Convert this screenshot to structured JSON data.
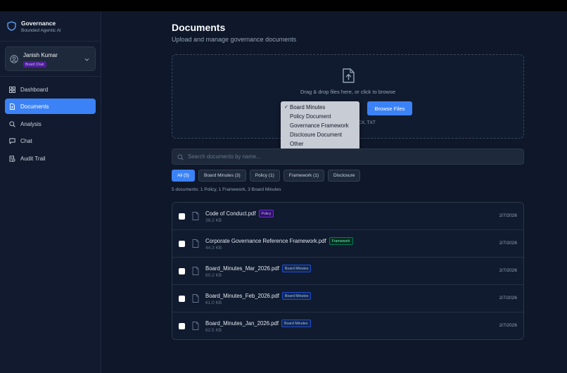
{
  "brand": {
    "title": "Governance",
    "subtitle": "Bounded Agentic AI"
  },
  "user": {
    "name": "Janish Kumar",
    "role": "Board Chair"
  },
  "nav": {
    "items": [
      {
        "label": "Dashboard",
        "icon": "dashboard-icon",
        "active": false
      },
      {
        "label": "Documents",
        "icon": "document-icon",
        "active": true
      },
      {
        "label": "Analysis",
        "icon": "search-icon",
        "active": false
      },
      {
        "label": "Chat",
        "icon": "chat-icon",
        "active": false
      },
      {
        "label": "Audit Trail",
        "icon": "audit-trail-icon",
        "active": false
      }
    ]
  },
  "page": {
    "title": "Documents",
    "subtitle": "Upload and manage governance documents"
  },
  "upload": {
    "instructions": "Drag & drop files here, or click to browse",
    "browse_label": "Browse Files",
    "formats_visible": "CX, TXT",
    "doc_type_options": [
      {
        "label": "Board Minutes",
        "selected": true
      },
      {
        "label": "Policy Document",
        "selected": false
      },
      {
        "label": "Governance Framework",
        "selected": false
      },
      {
        "label": "Disclosure Document",
        "selected": false
      },
      {
        "label": "Other",
        "selected": false
      }
    ],
    "check_glyph": "✓"
  },
  "search": {
    "placeholder": "Search documents by name..."
  },
  "filters": [
    {
      "label": "All (5)",
      "active": true
    },
    {
      "label": "Board Minutes (3)",
      "active": false
    },
    {
      "label": "Policy (1)",
      "active": false
    },
    {
      "label": "Framework (1)",
      "active": false
    },
    {
      "label": "Disclosure",
      "active": false
    }
  ],
  "summary": "5 documents: 1 Policy, 1 Framework, 3 Board Minutes",
  "documents": [
    {
      "name": "Code of Conduct.pdf",
      "badge": "Policy",
      "badge_type": "policy",
      "size": "38.2 KB",
      "date": "2/7/2026"
    },
    {
      "name": "Corporate Governance Reference Framework.pdf",
      "badge": "Framework",
      "badge_type": "framework",
      "size": "44.3 KB",
      "date": "2/7/2026"
    },
    {
      "name": "Board_Minutes_Mar_2026.pdf",
      "badge": "Board Minutes",
      "badge_type": "minutes",
      "size": "60.2 KB",
      "date": "2/7/2026"
    },
    {
      "name": "Board_Minutes_Feb_2026.pdf",
      "badge": "Board Minutes",
      "badge_type": "minutes",
      "size": "61.0 KB",
      "date": "2/7/2026"
    },
    {
      "name": "Board_Minutes_Jan_2026.pdf",
      "badge": "Board Minutes",
      "badge_type": "minutes",
      "size": "62.5 KB",
      "date": "2/7/2026"
    }
  ],
  "colors": {
    "accent": "#3b82f6",
    "background": "#0f172a",
    "sidebar": "#111a2e"
  }
}
